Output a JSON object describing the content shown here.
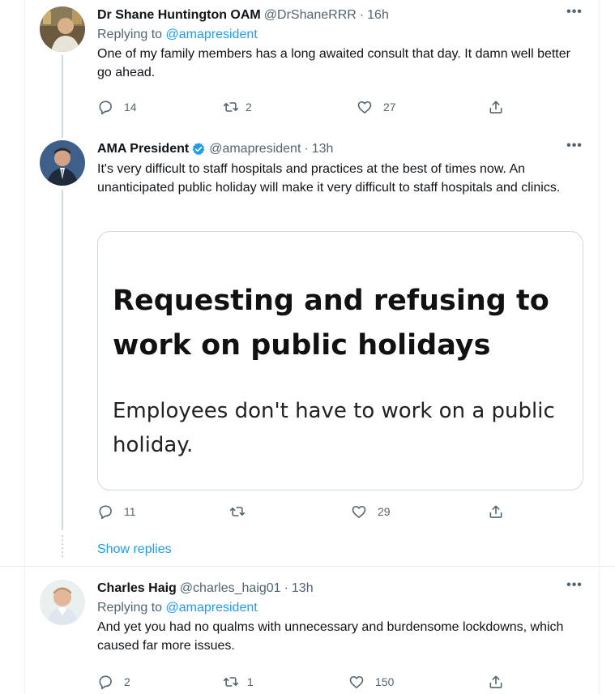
{
  "tweets": [
    {
      "name": "Dr Shane Huntington OAM",
      "handle": "@DrShaneRRR",
      "time": "16h",
      "verified": false,
      "replying_label": "Replying to",
      "replying_to": "@amapresident",
      "text": "One of my family members has a long awaited consult that day. It damn well better go ahead.",
      "replies": "14",
      "retweets": "2",
      "likes": "27"
    },
    {
      "name": "AMA President",
      "handle": "@amapresident",
      "time": "13h",
      "verified": true,
      "text": "It's very difficult to staff hospitals and practices at the best of times now. An unanticipated public holiday will make it very difficult to staff hospitals and clinics.",
      "card": {
        "title": "Requesting and refusing to work on public holidays",
        "body": "Employees don't have to work on a public holiday."
      },
      "replies": "11",
      "retweets": "",
      "likes": "29"
    },
    {
      "name": "Charles Haig",
      "handle": "@charles_haig01",
      "time": "13h",
      "verified": false,
      "replying_label": "Replying to",
      "replying_to": "@amapresident",
      "text": "And yet you had no qualms with unnecessary and burdensome lockdowns, which caused far more issues.",
      "replies": "2",
      "retweets": "1",
      "likes": "150"
    }
  ],
  "show_replies": "Show replies",
  "separator": "·",
  "more_glyph": "•••",
  "icons": {
    "reply": "reply-icon",
    "retweet": "retweet-icon",
    "like": "like-icon",
    "share": "share-icon",
    "verified": "verified-badge-icon",
    "more": "more-options-icon"
  },
  "colors": {
    "link": "#1d9bf0",
    "secondary_text": "#536471",
    "primary_text": "#0f1419",
    "thread_line": "#cfd9de"
  }
}
